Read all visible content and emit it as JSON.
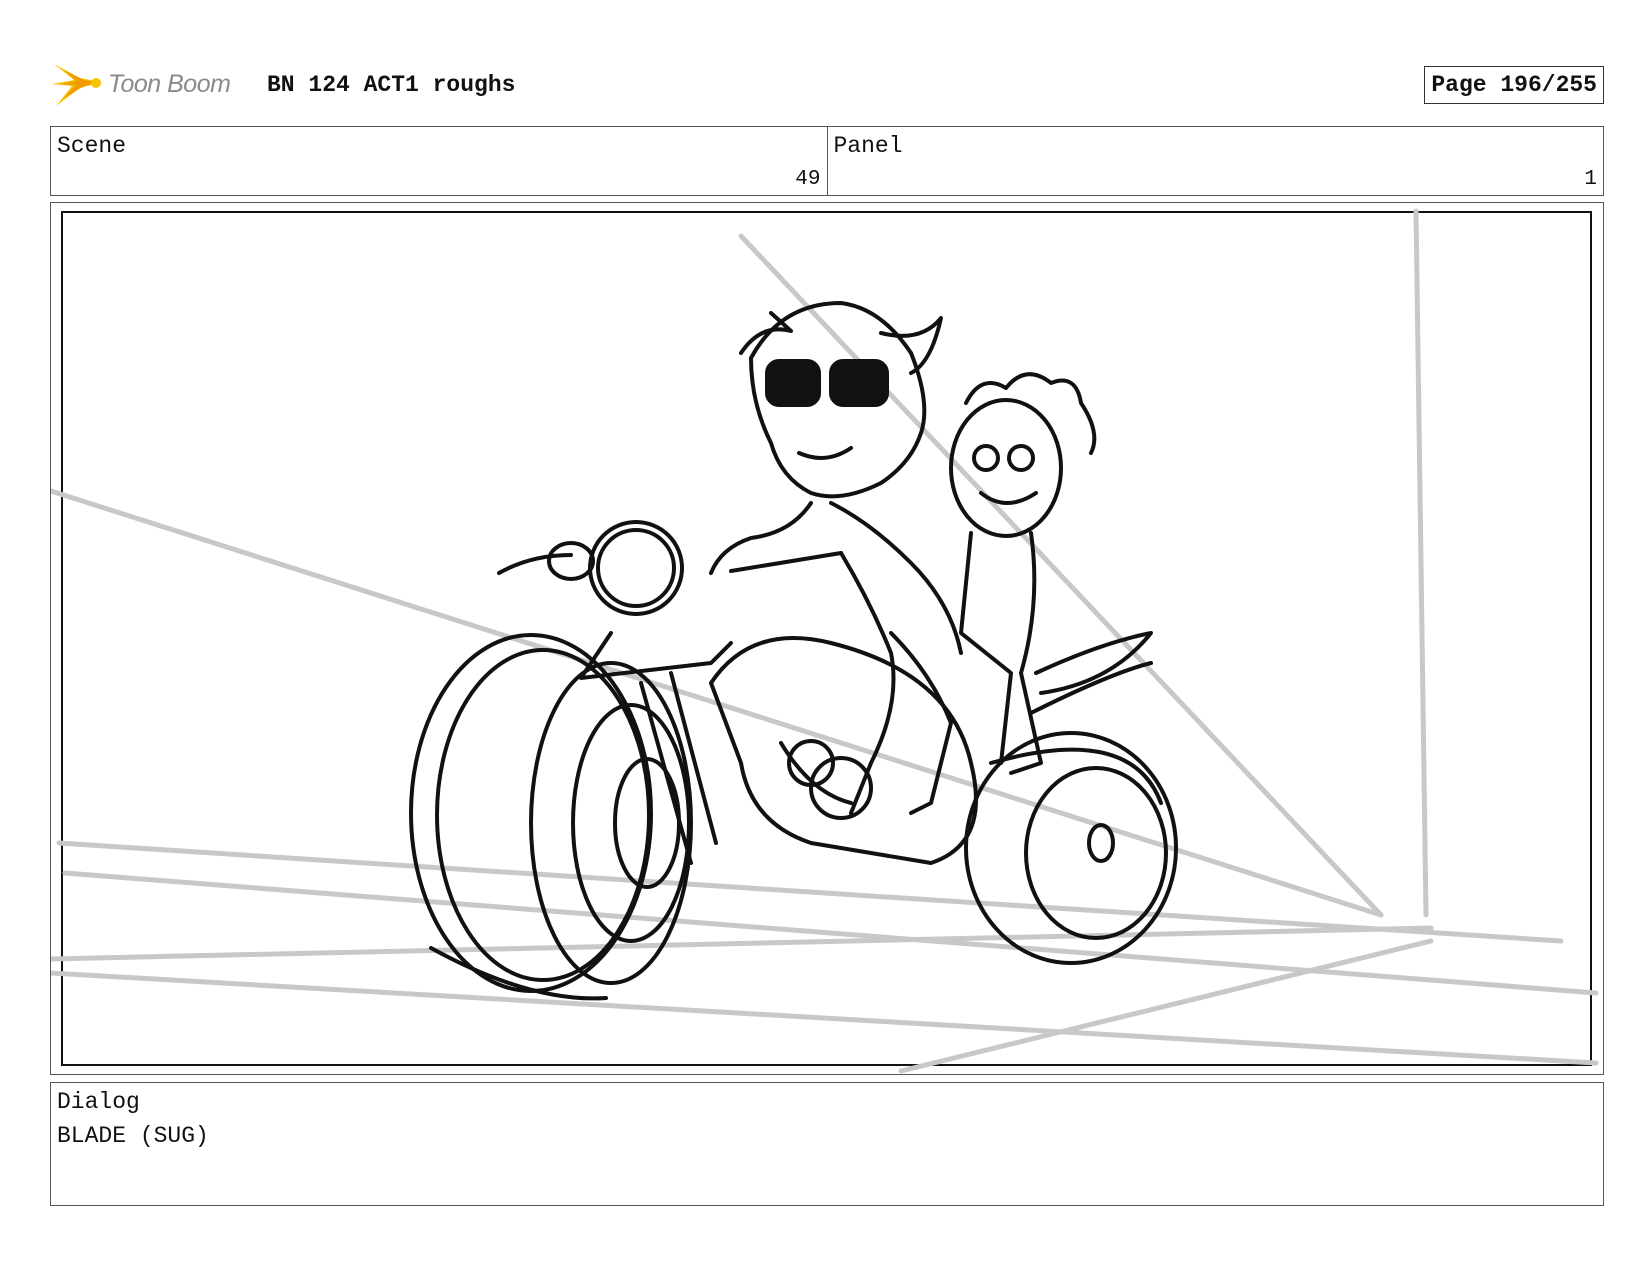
{
  "header": {
    "logo_text": "Toon Boom",
    "title": "BN 124 ACT1 roughs",
    "page_label": "Page 196/255"
  },
  "info": {
    "scene_label": "Scene",
    "scene_value": "49",
    "panel_label": "Panel",
    "panel_value": "1"
  },
  "dialog": {
    "label": "Dialog",
    "text": "BLADE (SUG)"
  },
  "colors": {
    "logo_yellow": "#f5c400",
    "logo_orange": "#f09a00",
    "sketch_ink": "#111111",
    "perspective_lines": "#c8c8c8"
  }
}
